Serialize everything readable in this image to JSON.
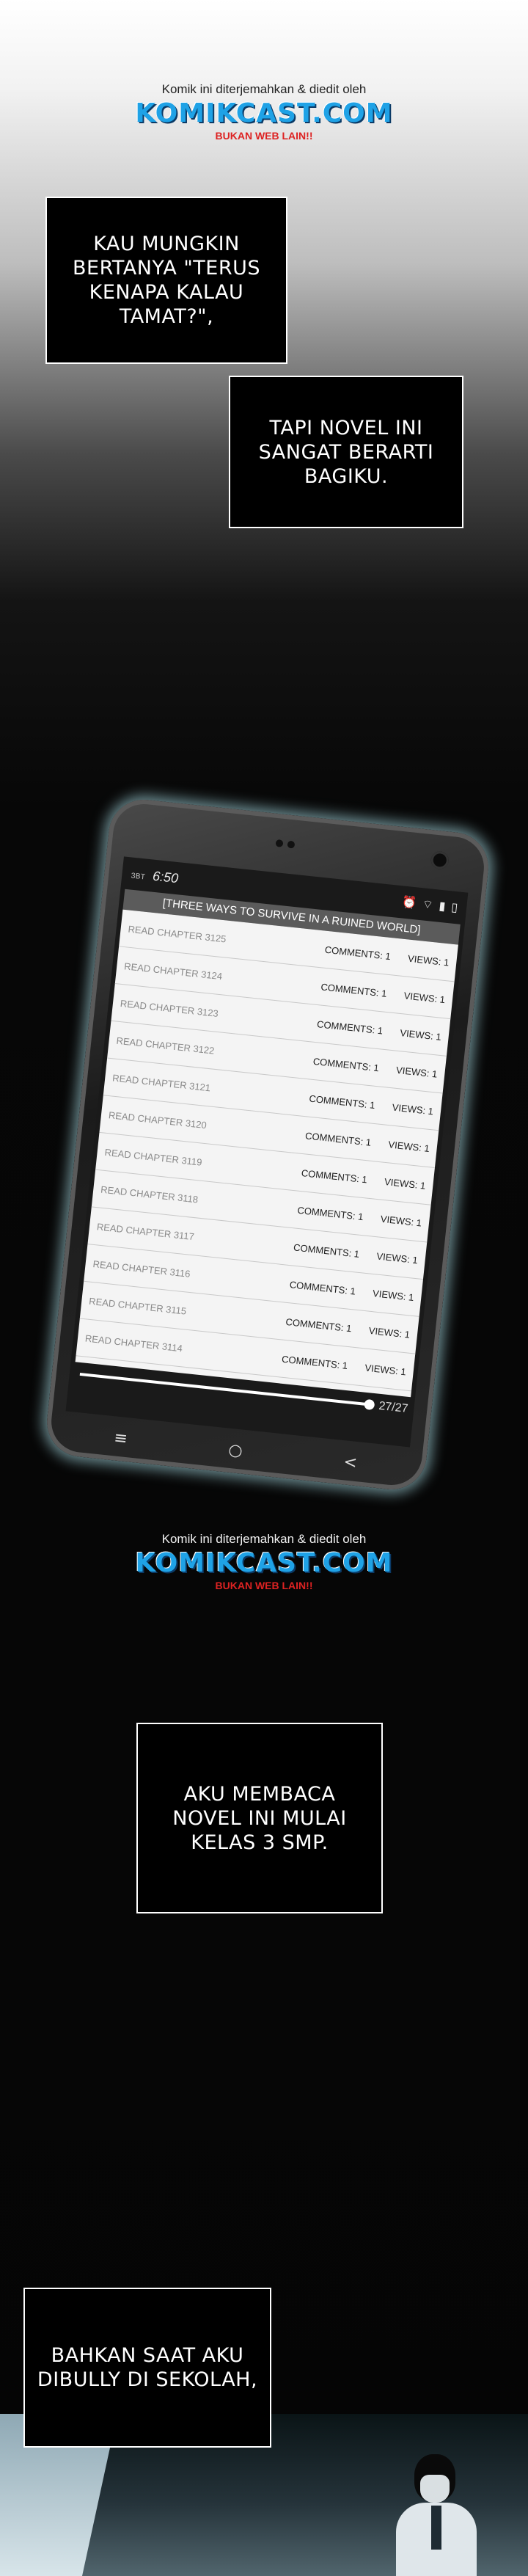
{
  "watermark": {
    "credit": "Komik ini diterjemahkan & diedit oleh",
    "logo": "KOMIKCAST.COM",
    "tagline": "BUKAN WEB LAIN!!"
  },
  "captions": [
    {
      "text": "KAU MUNGKIN\nBERTANYA \"TERUS\nKENAPA KALAU\nTAMAT?\","
    },
    {
      "text": "TAPI NOVEL INI\nSANGAT BERARTI\nBAGIKU."
    },
    {
      "text": "AKU MEMBACA\nNOVEL INI MULAI\nKELAS 3 SMP."
    },
    {
      "text": "BAHKAN SAAT AKU\nDIBULLY DI SEKOLAH,"
    }
  ],
  "phone": {
    "carrier": "3BT",
    "time": "6:50",
    "status_icons": [
      "alarm-icon",
      "wifi-icon",
      "signal-icon",
      "battery-icon"
    ],
    "app_title": "[THREE WAYS TO SURVIVE IN A RUINED WORLD]",
    "chapters": [
      {
        "title": "READ CHAPTER 3125",
        "comments": "COMMENTS: 1",
        "views": "VIEWS: 1"
      },
      {
        "title": "READ CHAPTER 3124",
        "comments": "COMMENTS: 1",
        "views": "VIEWS: 1"
      },
      {
        "title": "READ CHAPTER 3123",
        "comments": "COMMENTS: 1",
        "views": "VIEWS: 1"
      },
      {
        "title": "READ CHAPTER 3122",
        "comments": "COMMENTS: 1",
        "views": "VIEWS: 1"
      },
      {
        "title": "READ CHAPTER 3121",
        "comments": "COMMENTS: 1",
        "views": "VIEWS: 1"
      },
      {
        "title": "READ CHAPTER 3120",
        "comments": "COMMENTS: 1",
        "views": "VIEWS: 1"
      },
      {
        "title": "READ CHAPTER 3119",
        "comments": "COMMENTS: 1",
        "views": "VIEWS: 1"
      },
      {
        "title": "READ CHAPTER 3118",
        "comments": "COMMENTS: 1",
        "views": "VIEWS: 1"
      },
      {
        "title": "READ CHAPTER 3117",
        "comments": "COMMENTS: 1",
        "views": "VIEWS: 1"
      },
      {
        "title": "READ CHAPTER 3116",
        "comments": "COMMENTS: 1",
        "views": "VIEWS: 1"
      },
      {
        "title": "READ CHAPTER 3115",
        "comments": "COMMENTS: 1",
        "views": "VIEWS: 1"
      },
      {
        "title": "READ CHAPTER 3114",
        "comments": "COMMENTS: 1",
        "views": "VIEWS: 1"
      }
    ],
    "pager": "27/27",
    "progress": 1.0,
    "nav_icons": [
      "menu-icon",
      "home-icon",
      "back-icon"
    ]
  }
}
